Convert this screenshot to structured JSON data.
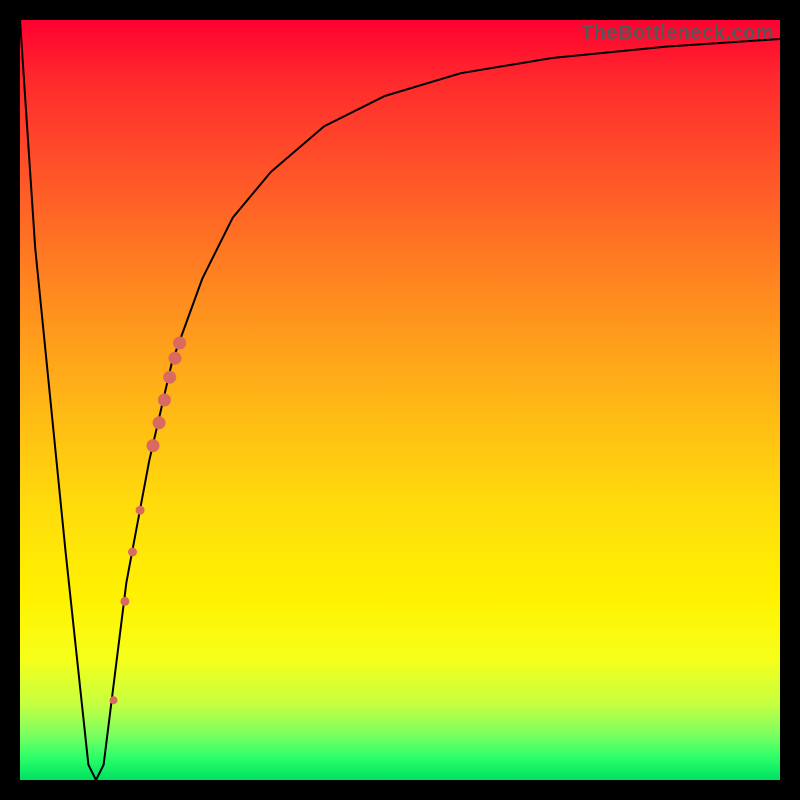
{
  "watermark": "TheBottleneck.com",
  "chart_data": {
    "type": "line",
    "title": "",
    "xlabel": "",
    "ylabel": "",
    "xlim": [
      0,
      100
    ],
    "ylim": [
      0,
      100
    ],
    "series": [
      {
        "name": "bottleneck-curve",
        "x": [
          0,
          2,
          6,
          9,
          10,
          11,
          12,
          14,
          17,
          20,
          24,
          28,
          33,
          40,
          48,
          58,
          70,
          85,
          100
        ],
        "values": [
          100,
          70,
          30,
          2,
          0,
          2,
          10,
          26,
          42,
          55,
          66,
          74,
          80,
          86,
          90,
          93,
          95,
          96.5,
          97.5
        ]
      }
    ],
    "markers": [
      {
        "x": 12.3,
        "y": 10.5,
        "r": 4.0
      },
      {
        "x": 13.8,
        "y": 23.5,
        "r": 4.5
      },
      {
        "x": 14.8,
        "y": 30.0,
        "r": 4.5
      },
      {
        "x": 15.8,
        "y": 35.5,
        "r": 4.5
      },
      {
        "x": 17.5,
        "y": 44.0,
        "r": 6.5
      },
      {
        "x": 18.3,
        "y": 47.0,
        "r": 6.5
      },
      {
        "x": 19.0,
        "y": 50.0,
        "r": 6.5
      },
      {
        "x": 19.7,
        "y": 53.0,
        "r": 6.5
      },
      {
        "x": 20.4,
        "y": 55.5,
        "r": 6.5
      },
      {
        "x": 21.0,
        "y": 57.5,
        "r": 6.5
      }
    ],
    "colors": {
      "curve": "#000000",
      "marker": "#d86a5f"
    }
  }
}
